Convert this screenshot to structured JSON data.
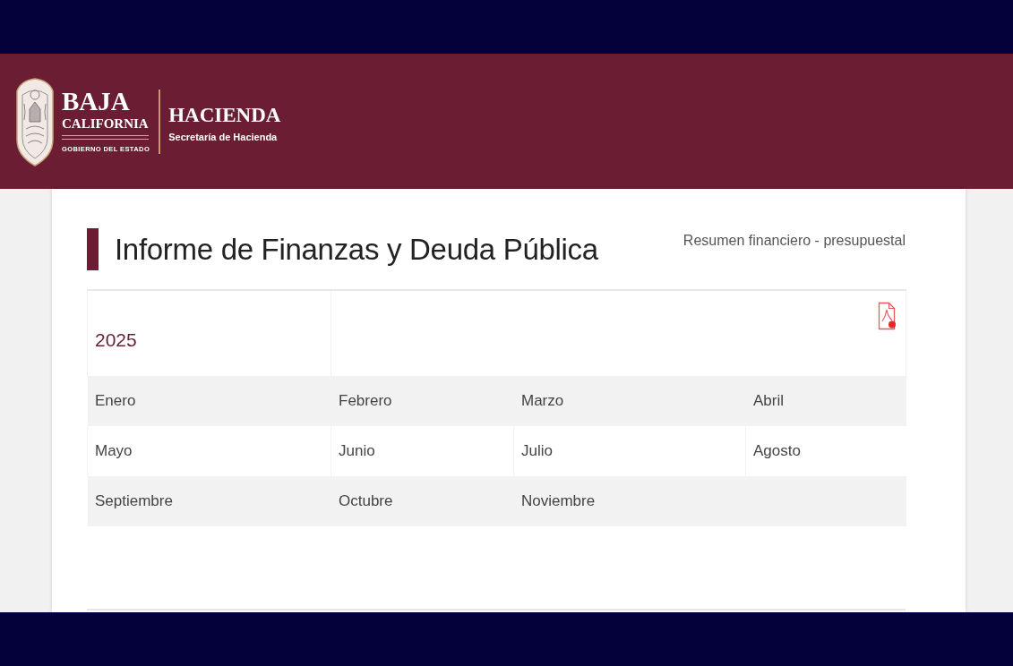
{
  "header": {
    "logo": {
      "name_line_1": "BAJA",
      "name_line_2": "CALIFORNIA",
      "tagline": "GOBIERNO DEL ESTADO"
    },
    "department": {
      "title": "HACIENDA",
      "subtitle": "Secretaría de Hacienda"
    }
  },
  "page": {
    "title": "Informe de Finanzas y Deuda Pública",
    "subtitle": "Resumen financiero - presupuestal"
  },
  "table": {
    "year": "2025",
    "rows": [
      {
        "cells": [
          "Enero",
          "Febrero",
          "Marzo",
          "Abril"
        ]
      },
      {
        "cells": [
          "Mayo",
          "Junio",
          "Julio",
          "Agosto"
        ]
      },
      {
        "cells": [
          "Septiembre",
          "Octubre",
          "Noviembre"
        ]
      }
    ]
  }
}
